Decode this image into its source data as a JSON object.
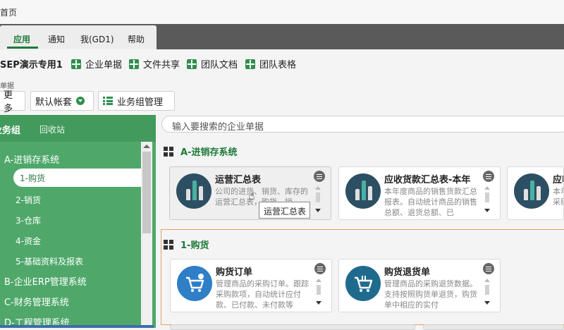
{
  "window": {
    "title": "首页"
  },
  "menubar": {
    "tabs": [
      "应用",
      "通知",
      "我(GD1)",
      "帮助"
    ]
  },
  "toolbar1": {
    "workspace": "SEP演示专用1",
    "items": [
      "企业单据",
      "文件共享",
      "团队文档",
      "团队表格"
    ]
  },
  "subbar": {
    "label": "单据",
    "more": "更多",
    "account": "默认帐套",
    "group_manage": "业务组管理"
  },
  "sidebar": {
    "tab_active": "业务组",
    "tab_recycle": "回收站",
    "items": [
      {
        "label": "A-进销存系统",
        "level": 1
      },
      {
        "label": "1-购货",
        "level": 2,
        "selected": true
      },
      {
        "label": "2-销货",
        "level": 2
      },
      {
        "label": "3-仓库",
        "level": 2
      },
      {
        "label": "4-资金",
        "level": 2
      },
      {
        "label": "5-基础资料及报表",
        "level": 2
      },
      {
        "label": "B-企业ERP管理系统",
        "level": 1
      },
      {
        "label": "C-财务管理系统",
        "level": 1
      },
      {
        "label": "D-工程管理系统",
        "level": 1
      }
    ]
  },
  "search": {
    "placeholder": "输入要搜索的企业单据"
  },
  "sections": [
    {
      "title": "A-进销存系统",
      "cards": [
        {
          "title": "运营汇总表",
          "desc": "公司的进货、销货、库存的运营汇总表，购货、销",
          "icon": "chart-icon"
        },
        {
          "title": "应收货款汇总表-本年",
          "desc": "本年度商品的销售货款汇总报表。自动统计商品的销售总额、退货总额、已",
          "icon": "chart-icon"
        },
        {
          "title": "应收",
          "desc": "本年采购",
          "icon": "chart-icon"
        }
      ]
    },
    {
      "title": "1-购货",
      "cards": [
        {
          "title": "购货订单",
          "desc": "管理商品的采购订单。跟踪采购款项，自动统计应付款、已付款、未付款等",
          "icon": "cart-add-icon"
        },
        {
          "title": "购货退货单",
          "desc": "管理商品的采购退货数据。支持按照购货单退货，购货单中相应的实付",
          "icon": "cart-return-icon"
        }
      ]
    }
  ],
  "tooltip": {
    "text": "运营汇总表"
  },
  "colors": {
    "accent": "#1f7a3a",
    "sidebar": "#4fa86a",
    "menubar": "#5a5a5a"
  }
}
